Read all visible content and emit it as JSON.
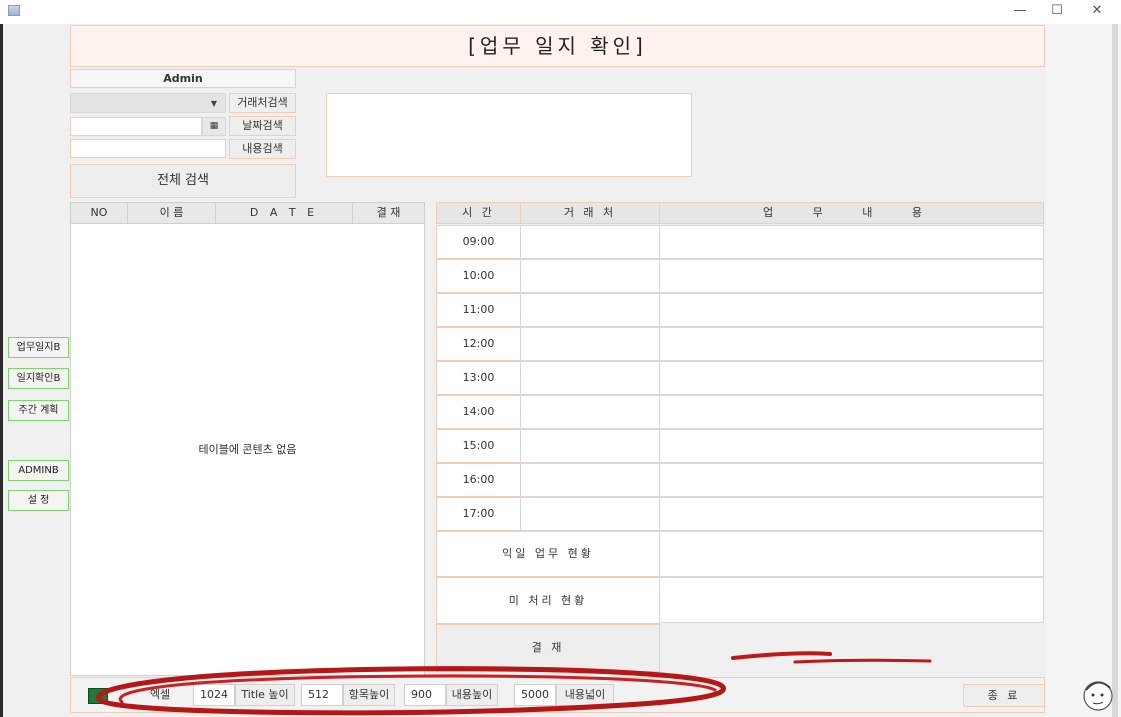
{
  "window": {
    "minimize": "—",
    "maximize": "☐",
    "close": "✕"
  },
  "header": {
    "title": "[업무 일지 확인]"
  },
  "search": {
    "user": "Admin",
    "calendar_icon": "calendar-icon",
    "client_search": "거래처검색",
    "date_search": "날짜검색",
    "content_search": "내용검색",
    "search_all": "전체 검색"
  },
  "list_table": {
    "columns": [
      "NO",
      "이 름",
      "D A T E",
      "결 재"
    ],
    "empty_message": "테이블에 콘텐츠 없음"
  },
  "schedule": {
    "columns": [
      "시 간",
      "거 래 처",
      "업 무 내 용"
    ],
    "times": [
      "09:00",
      "10:00",
      "11:00",
      "12:00",
      "13:00",
      "14:00",
      "15:00",
      "16:00",
      "17:00"
    ],
    "next_day_label": "익일 업무 현황",
    "pending_label": "미 처리 현황",
    "approve_label": "결 재"
  },
  "side_nav": [
    "업무일지B",
    "일지확인B",
    "주간 계획",
    "ADMINB",
    "설 정"
  ],
  "toolbar": {
    "excel_label": "엑셀",
    "title_height_value": "1024",
    "title_height_label": "Title 높이",
    "item_height_value": "512",
    "item_height_label": "항목높이",
    "content_height_value": "900",
    "content_height_label": "내용높이",
    "content_width_value": "5000",
    "content_width_label": "내용넓이",
    "close_label": "종 료"
  },
  "colors": {
    "accent_border": "#f1cdb8",
    "header_bg": "#fff2ef",
    "nav_border": "#7ed36a",
    "annotation": "#c01818"
  }
}
